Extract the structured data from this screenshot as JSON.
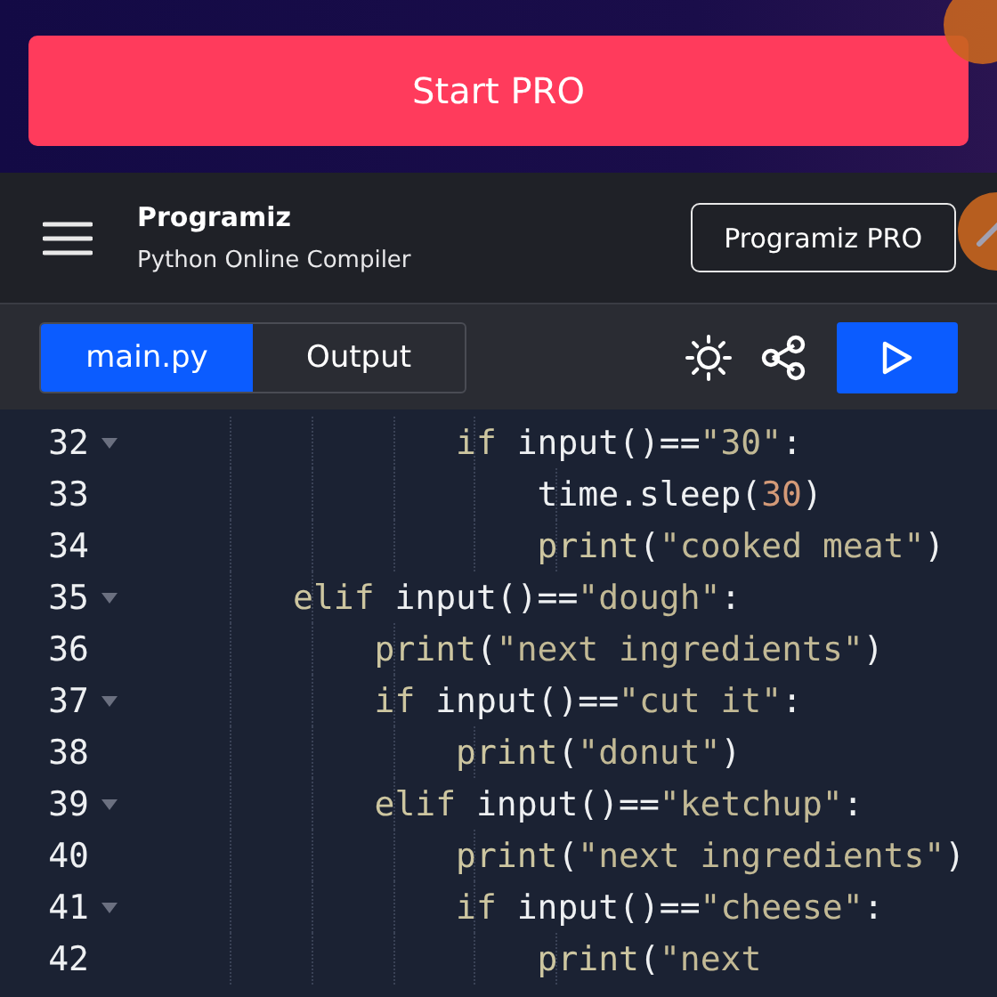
{
  "promo": {
    "button": "Start PRO"
  },
  "header": {
    "logo": "Programiz",
    "subtitle": "Python Online Compiler",
    "pro_button": "Programiz PRO"
  },
  "tabs": [
    {
      "label": "main.py",
      "selected": true
    },
    {
      "label": "Output",
      "selected": false
    }
  ],
  "code_lines": [
    {
      "number": "32",
      "foldable": true,
      "tokens": [
        {
          "text": "                if",
          "kind": "keyword"
        },
        {
          "text": " input()==",
          "kind": "plain"
        },
        {
          "text": "\"30\"",
          "kind": "string"
        },
        {
          "text": ":",
          "kind": "plain"
        }
      ]
    },
    {
      "number": "33",
      "foldable": false,
      "tokens": [
        {
          "text": "                    time.sleep(",
          "kind": "plain"
        },
        {
          "text": "30",
          "kind": "number"
        },
        {
          "text": ")",
          "kind": "plain"
        }
      ]
    },
    {
      "number": "34",
      "foldable": false,
      "tokens": [
        {
          "text": "                    print",
          "kind": "keyword"
        },
        {
          "text": "(",
          "kind": "plain"
        },
        {
          "text": "\"cooked meat\"",
          "kind": "string"
        },
        {
          "text": ")",
          "kind": "plain"
        }
      ]
    },
    {
      "number": "35",
      "foldable": true,
      "tokens": [
        {
          "text": "        elif",
          "kind": "keyword"
        },
        {
          "text": " input()==",
          "kind": "plain"
        },
        {
          "text": "\"dough\"",
          "kind": "string"
        },
        {
          "text": ":",
          "kind": "plain"
        }
      ]
    },
    {
      "number": "36",
      "foldable": false,
      "tokens": [
        {
          "text": "            print",
          "kind": "keyword"
        },
        {
          "text": "(",
          "kind": "plain"
        },
        {
          "text": "\"next ingredients\"",
          "kind": "string"
        },
        {
          "text": ")",
          "kind": "plain"
        }
      ]
    },
    {
      "number": "37",
      "foldable": true,
      "tokens": [
        {
          "text": "            if",
          "kind": "keyword"
        },
        {
          "text": " input()==",
          "kind": "plain"
        },
        {
          "text": "\"cut it\"",
          "kind": "string"
        },
        {
          "text": ":",
          "kind": "plain"
        }
      ]
    },
    {
      "number": "38",
      "foldable": false,
      "tokens": [
        {
          "text": "                print",
          "kind": "keyword"
        },
        {
          "text": "(",
          "kind": "plain"
        },
        {
          "text": "\"donut\"",
          "kind": "string"
        },
        {
          "text": ")",
          "kind": "plain"
        }
      ]
    },
    {
      "number": "39",
      "foldable": true,
      "tokens": [
        {
          "text": "            elif",
          "kind": "keyword"
        },
        {
          "text": " input()==",
          "kind": "plain"
        },
        {
          "text": "\"ketchup\"",
          "kind": "string"
        },
        {
          "text": ":",
          "kind": "plain"
        }
      ]
    },
    {
      "number": "40",
      "foldable": false,
      "tokens": [
        {
          "text": "                print",
          "kind": "keyword"
        },
        {
          "text": "(",
          "kind": "plain"
        },
        {
          "text": "\"next ingredients\"",
          "kind": "string"
        },
        {
          "text": ")",
          "kind": "plain"
        }
      ]
    },
    {
      "number": "41",
      "foldable": true,
      "tokens": [
        {
          "text": "                if",
          "kind": "keyword"
        },
        {
          "text": " input()==",
          "kind": "plain"
        },
        {
          "text": "\"cheese\"",
          "kind": "string"
        },
        {
          "text": ":",
          "kind": "plain"
        }
      ]
    },
    {
      "number": "42",
      "foldable": false,
      "tokens": [
        {
          "text": "                    print",
          "kind": "keyword"
        },
        {
          "text": "(",
          "kind": "plain"
        },
        {
          "text": "\"next",
          "kind": "string"
        }
      ]
    }
  ]
}
